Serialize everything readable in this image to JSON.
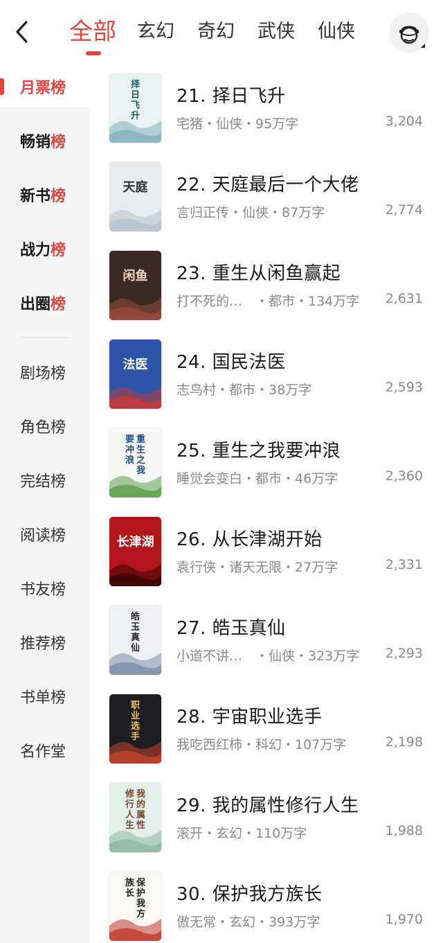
{
  "header": {
    "back_icon": "chevron-left-icon",
    "tabs": [
      {
        "label": "全部",
        "active": true
      },
      {
        "label": "玄幻"
      },
      {
        "label": "奇幻"
      },
      {
        "label": "武侠"
      },
      {
        "label": "仙侠"
      }
    ],
    "avatar_icon": "reader-avatar-icon"
  },
  "sidebar": {
    "items": [
      {
        "label": "月票榜",
        "active": true
      },
      {
        "label": "畅销榜",
        "head": "畅销",
        "tail": "榜"
      },
      {
        "label": "新书榜",
        "head": "新书",
        "tail": "榜"
      },
      {
        "label": "战力榜",
        "head": "战力",
        "tail": "榜"
      },
      {
        "label": "出圈榜",
        "head": "出圈",
        "tail": "榜"
      },
      {
        "label": "剧场榜"
      },
      {
        "label": "角色榜"
      },
      {
        "label": "完结榜"
      },
      {
        "label": "阅读榜"
      },
      {
        "label": "书友榜"
      },
      {
        "label": "推荐榜"
      },
      {
        "label": "书单榜"
      },
      {
        "label": "名作堂"
      }
    ]
  },
  "books": [
    {
      "title": "21. 择日飞升",
      "meta": "宅猪・仙侠・95万字",
      "count": "3,204"
    },
    {
      "title": "22. 天庭最后一个大佬",
      "meta": "言归正传・仙侠・87万字",
      "count": "2,774"
    },
    {
      "title": "23. 重生从闲鱼赢起",
      "meta": "打不死的…　・都市・134万字",
      "count": "2,631"
    },
    {
      "title": "24. 国民法医",
      "meta": "志鸟村・都市・38万字",
      "count": "2,593"
    },
    {
      "title": "25. 重生之我要冲浪",
      "meta": "睡觉会变白・都市・46万字",
      "count": "2,360"
    },
    {
      "title": "26. 从长津湖开始",
      "meta": "袁行侠・诸天无限・27万字",
      "count": "2,331"
    },
    {
      "title": "27. 皓玉真仙",
      "meta": "小道不讲…　・仙侠・323万字",
      "count": "2,293"
    },
    {
      "title": "28. 宇宙职业选手",
      "meta": "我吃西红柿・科幻・107万字",
      "count": "2,198"
    },
    {
      "title": "29. 我的属性修行人生",
      "meta": "滚开・玄幻・110万字",
      "count": "1,988"
    },
    {
      "title": "30. 保护我方族长",
      "meta": "傲无常・玄幻・393万字",
      "count": "1,970"
    }
  ],
  "covers": [
    {
      "title": "择日飞升",
      "bg": "#e9f1f3",
      "fg": "#1f5f6e",
      "accent": "#7fb3b9"
    },
    {
      "title": "天庭",
      "bg": "#e8ecee",
      "fg": "#2d3238",
      "accent": "#b8c4cc"
    },
    {
      "title": "闲鱼",
      "bg": "#3a2a25",
      "fg": "#f0d7c8",
      "accent": "#9b4a3b"
    },
    {
      "title": "法医",
      "bg": "#2c55a8",
      "fg": "#ffffff",
      "accent": "#c73a3a"
    },
    {
      "title": "重生之我要冲浪",
      "bg": "#f7f8f6",
      "fg": "#1d4f86",
      "accent": "#5aa04a"
    },
    {
      "title": "长津湖",
      "bg": "#b3161a",
      "fg": "#ffffff",
      "accent": "#3a0606"
    },
    {
      "title": "皓玉真仙",
      "bg": "#eef0f3",
      "fg": "#2a2a2a",
      "accent": "#7e8fa6"
    },
    {
      "title": "职业选手",
      "bg": "#1d1d22",
      "fg": "#f2c24a",
      "accent": "#c7432c"
    },
    {
      "title": "我的属性修行人生",
      "bg": "#e3efe9",
      "fg": "#7a4a2f",
      "accent": "#8ab8a5"
    },
    {
      "title": "保护我方族长",
      "bg": "#faf8f4",
      "fg": "#222222",
      "accent": "#c0392b"
    }
  ],
  "colors": {
    "accent": "#e8443e",
    "sidebar_bg": "#f5f5f5",
    "meta_text": "#8a8a8a"
  }
}
